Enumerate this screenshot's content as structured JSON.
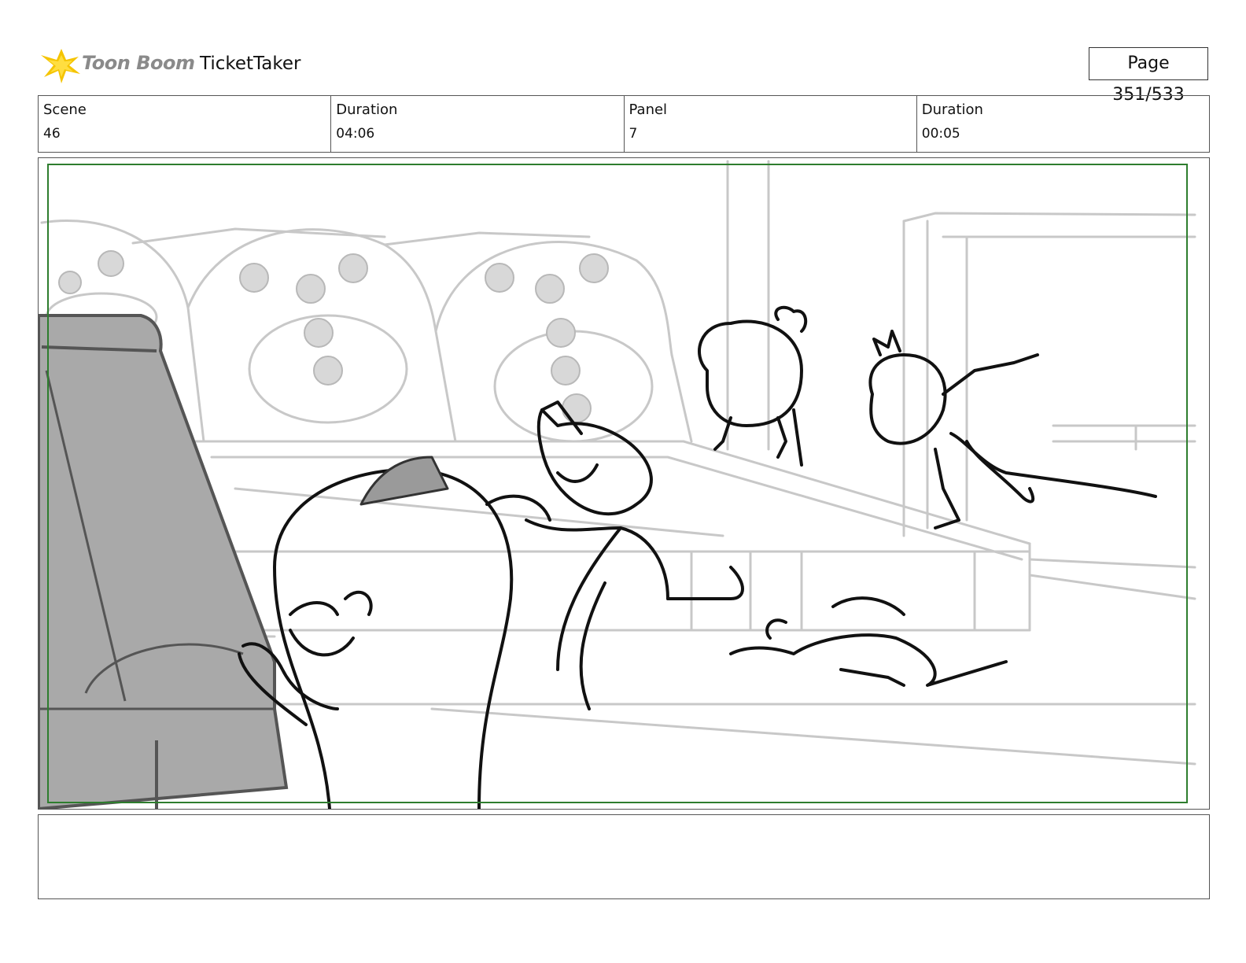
{
  "header": {
    "logo_text": "Toon Boom",
    "project_title": "TicketTaker",
    "page_label": "Page 351/533"
  },
  "info": {
    "scene_label": "Scene",
    "scene_value": "46",
    "scene_duration_label": "Duration",
    "scene_duration_value": "04:06",
    "panel_label": "Panel",
    "panel_value": "7",
    "panel_duration_label": "Duration",
    "panel_duration_value": "00:05"
  },
  "panel": {
    "safe_frame_color": "#2e7d2e",
    "content": "storyboard-sketch"
  },
  "notes": {
    "text": ""
  }
}
